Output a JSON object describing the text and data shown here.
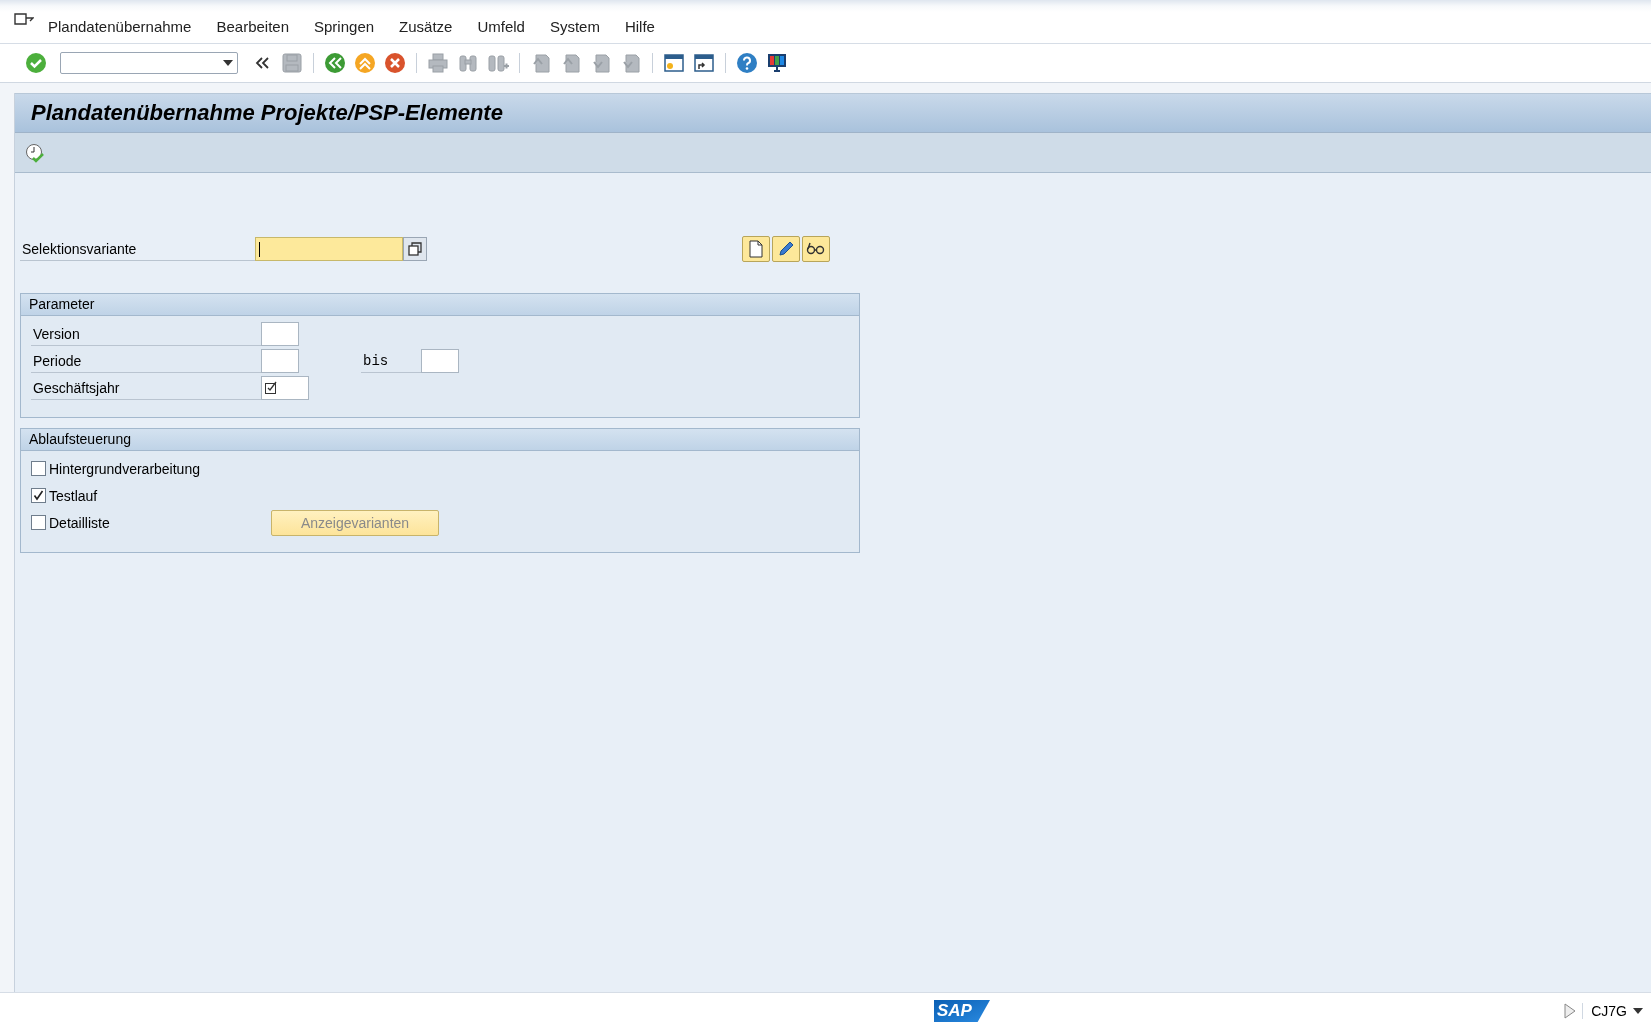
{
  "menu": [
    "Plandatenübernahme",
    "Bearbeiten",
    "Springen",
    "Zusätze",
    "Umfeld",
    "System",
    "Hilfe"
  ],
  "toolbar": [
    {
      "kind": "enter",
      "disabled": false
    },
    {
      "kind": "command"
    },
    {
      "kind": "collapse",
      "disabled": false
    },
    {
      "kind": "save",
      "disabled": true
    },
    {
      "kind": "separator"
    },
    {
      "kind": "back",
      "disabled": false
    },
    {
      "kind": "exit",
      "disabled": false
    },
    {
      "kind": "cancel",
      "disabled": false
    },
    {
      "kind": "separator"
    },
    {
      "kind": "print",
      "disabled": true
    },
    {
      "kind": "find",
      "disabled": true
    },
    {
      "kind": "find-next",
      "disabled": true
    },
    {
      "kind": "separator"
    },
    {
      "kind": "first-page",
      "disabled": true
    },
    {
      "kind": "previous-page",
      "disabled": true
    },
    {
      "kind": "next-page",
      "disabled": true
    },
    {
      "kind": "last-page",
      "disabled": true
    },
    {
      "kind": "separator"
    },
    {
      "kind": "new-session",
      "disabled": false
    },
    {
      "kind": "shortcut",
      "disabled": false
    },
    {
      "kind": "separator"
    },
    {
      "kind": "help",
      "disabled": false
    },
    {
      "kind": "layout",
      "disabled": false
    }
  ],
  "title": "Plandatenübernahme Projekte/PSP-Elemente",
  "variant": {
    "label": "Selektionsvariante",
    "focused": true
  },
  "parameter_group": {
    "title": "Parameter",
    "fields": [
      {
        "label": "Version",
        "required": false
      },
      {
        "label": "Periode",
        "required": false,
        "to_label": "bis"
      },
      {
        "label": "Geschäftsjahr",
        "required": true
      }
    ]
  },
  "control_group": {
    "title": "Ablaufsteuerung",
    "options": [
      {
        "label": "Hintergrundverarbeitung",
        "checked": false
      },
      {
        "label": "Testlauf",
        "checked": true
      },
      {
        "label": "Detailliste",
        "checked": false
      }
    ],
    "button": {
      "label": "Anzeigevarianten",
      "disabled": true
    }
  },
  "status_bar": {
    "logo": "SAP",
    "transaction": "CJ7G"
  }
}
